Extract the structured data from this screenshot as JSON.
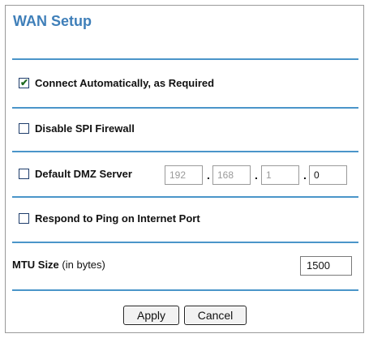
{
  "title": "WAN Setup",
  "options": {
    "connect_auto": {
      "label": "Connect Automatically, as Required",
      "checked": true
    },
    "disable_spi": {
      "label": "Disable SPI Firewall",
      "checked": false
    },
    "dmz": {
      "label": "Default DMZ Server",
      "checked": false,
      "ip": [
        "192",
        "168",
        "1",
        "0"
      ]
    },
    "ping": {
      "label": "Respond to Ping on Internet Port",
      "checked": false
    }
  },
  "mtu": {
    "label_bold": "MTU Size",
    "label_rest": " (in bytes)",
    "value": "1500"
  },
  "buttons": {
    "apply": "Apply",
    "cancel": "Cancel"
  },
  "check_glyph": "✔"
}
